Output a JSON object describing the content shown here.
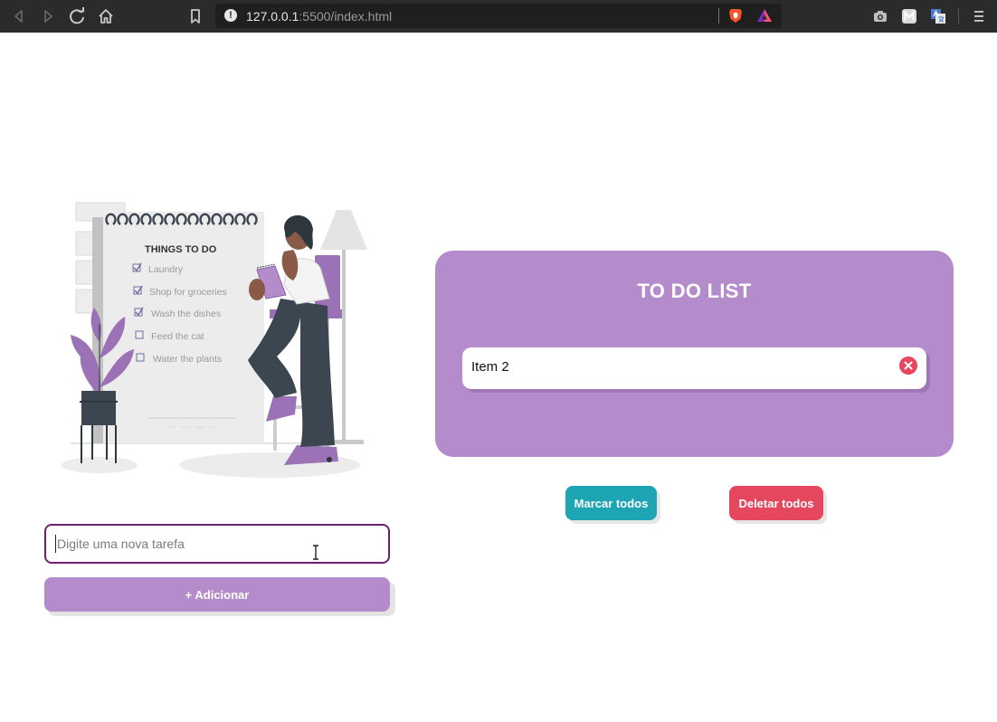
{
  "browser": {
    "url_host": "127.0.0.1",
    "url_rest": ":5500/index.html"
  },
  "illustration": {
    "heading": "THINGS TO DO",
    "items": [
      "Laundry",
      "Shop for groceries",
      "Wash the dishes",
      "Feed the cat",
      "Water the plants"
    ],
    "checked": [
      true,
      true,
      true,
      false,
      false
    ]
  },
  "form": {
    "placeholder": "Digite uma nova tarefa",
    "value": "",
    "add_label": "+ Adicionar"
  },
  "todo": {
    "title": "TO DO LIST",
    "items": [
      {
        "text": "Item 2"
      }
    ]
  },
  "actions": {
    "mark_all": "Marcar todos",
    "delete_all": "Deletar todos"
  },
  "colors": {
    "accent": "#b48ccb",
    "input_border": "#6e1f6e",
    "mark_button": "#1ea5b4",
    "delete_button": "#e5485e"
  }
}
